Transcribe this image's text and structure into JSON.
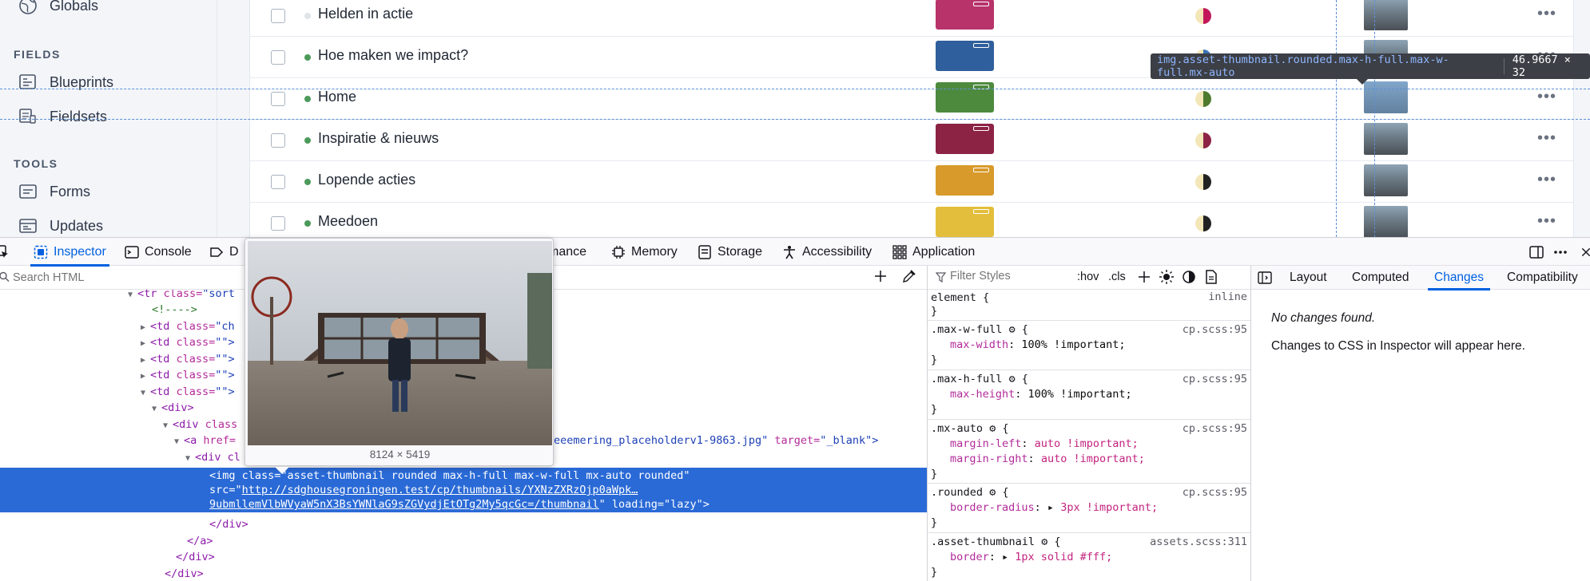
{
  "sidebar": {
    "items_top": [
      {
        "label": "Globals",
        "icon": "globe-icon"
      }
    ],
    "fields_heading": "FIELDS",
    "fields_items": [
      {
        "label": "Blueprints",
        "icon": "blueprint-icon"
      },
      {
        "label": "Fieldsets",
        "icon": "fieldset-icon"
      }
    ],
    "tools_heading": "TOOLS",
    "tools_items": [
      {
        "label": "Forms",
        "icon": "form-icon"
      },
      {
        "label": "Updates",
        "icon": "updates-icon"
      }
    ]
  },
  "table": {
    "rows": [
      {
        "title": "Helden in actie",
        "status_color": "#e1e4e8",
        "thumb_color": "#b8336a",
        "treelog_color": "#c2185b"
      },
      {
        "title": "Hoe maken we impact?",
        "status_color": "#4c9a5a",
        "thumb_color": "#2f5f9c",
        "treelog_color": "#3a74b8"
      },
      {
        "title": "Home",
        "status_color": "#4c9a5a",
        "thumb_color": "#4e8a3e",
        "treelog_color": "#4e7a2e"
      },
      {
        "title": "Inspiratie & nieuws",
        "status_color": "#4c9a5a",
        "thumb_color": "#8c2345",
        "treelog_color": "#8c2345"
      },
      {
        "title": "Lopende acties",
        "status_color": "#4c9a5a",
        "thumb_color": "#d89a2b",
        "treelog_color": "#222222"
      },
      {
        "title": "Meedoen",
        "status_color": "#4c9a5a",
        "thumb_color": "#e3be3c",
        "treelog_color": "#222222"
      }
    ],
    "more_label": "•••"
  },
  "highlight": {
    "selector": "img.asset-thumbnail.rounded.max-h-full.max-w-full.mx-auto",
    "size": "46.9667 × 32"
  },
  "devtools": {
    "tabs": [
      {
        "label": "Inspector",
        "icon": "inspector-icon"
      },
      {
        "label": "Console",
        "icon": "console-icon"
      },
      {
        "label": "D",
        "icon": "debugger-icon"
      },
      {
        "label": "mance",
        "icon": "performance-icon"
      },
      {
        "label": "Memory",
        "icon": "memory-icon"
      },
      {
        "label": "Storage",
        "icon": "storage-icon"
      },
      {
        "label": "Accessibility",
        "icon": "accessibility-icon"
      },
      {
        "label": "Application",
        "icon": "application-icon"
      }
    ],
    "search_placeholder": "Search HTML",
    "markup": {
      "l1_tag": "<tr",
      "l1_attr": " class=",
      "l1_val": "\"sort",
      "l2": "<!---->",
      "td_tag": "<td",
      "td_attr": " class=",
      "td_vals": [
        "\"ch",
        "\"\">",
        "\"\">",
        "\"\">",
        "\"\">"
      ],
      "div_open": "<div>",
      "div_class_tag": "<div",
      "div_class_attr": " class",
      "a_tag": "<a",
      "a_attr": " href=",
      "a_href_tail": "eeemering_placeholderv1-9863.jpg\"",
      "a_target_attr": " target=",
      "a_target_val": "\"_blank\">",
      "div_cl": "<div cl",
      "img_line1": "<img class=\"asset-thumbnail rounded max-h-full max-w-full mx-auto rounded\"",
      "img_src_attr": "src=\"",
      "img_src_url": "http://sdghousegroningen.test/cp/thumbnails/YXNzZXRzOjp0aWpk…",
      "img_src_url2": "9ubmllemVlbWVyaW5nX3BsYWNlaG9sZGVydjEtOTg2My5qcGc=/thumbnail",
      "img_loading": "\" loading=\"lazy\">",
      "close_div1": "</div>",
      "close_a": "</a>",
      "close_div2": "</div>",
      "close_div3": "</div>"
    },
    "styles": {
      "filter_placeholder": "Filter Styles",
      "hov": ":hov",
      "cls": ".cls",
      "rules": [
        {
          "selector": "element {",
          "source": "inline",
          "props": []
        },
        {
          "selector": ".max-w-full",
          "source": "cp.scss:95",
          "props": [
            {
              "name": "max-width",
              "value": "100% !important;"
            }
          ]
        },
        {
          "selector": ".max-h-full",
          "source": "cp.scss:95",
          "props": [
            {
              "name": "max-height",
              "value": "100% !important;"
            }
          ]
        },
        {
          "selector": ".mx-auto",
          "source": "cp.scss:95",
          "props": [
            {
              "name": "margin-left",
              "value": "auto !important;"
            },
            {
              "name": "margin-right",
              "value": "auto !important;"
            }
          ]
        },
        {
          "selector": ".rounded",
          "source": "cp.scss:95",
          "props": [
            {
              "name": "border-radius",
              "value": "3px !important;"
            }
          ]
        },
        {
          "selector": ".asset-thumbnail",
          "source": "assets.scss:311",
          "props": [
            {
              "name": "border",
              "value": "1px solid #fff;"
            }
          ]
        }
      ]
    },
    "side_tabs": [
      "Layout",
      "Computed",
      "Changes",
      "Compatibility"
    ],
    "changes_empty": "No changes found.",
    "changes_hint": "Changes to CSS in Inspector will appear here."
  },
  "preview": {
    "dimensions": "8124 × 5419"
  }
}
